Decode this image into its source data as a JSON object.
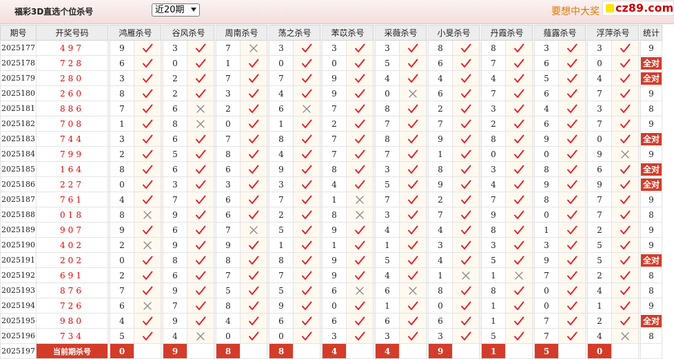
{
  "header": {
    "title": "福彩3D直选个位杀号",
    "period_select": "近20期",
    "promo": "要想中大奖",
    "brand": "cz89.com"
  },
  "table": {
    "columns": {
      "issue": "期号",
      "draw": "开奖号码",
      "stat": "统计",
      "experts": [
        "鸿雁杀号",
        "谷风杀号",
        "周南杀号",
        "荡之杀号",
        "苯苡杀号",
        "采薇杀号",
        "小旻杀号",
        "丹霞杀号",
        "薤露杀号",
        "浮萍杀号"
      ]
    },
    "rows": [
      {
        "issue": "2025177",
        "draw": "497",
        "picks": [
          [
            "9",
            "ok"
          ],
          [
            "3",
            "ok"
          ],
          [
            "7",
            "x"
          ],
          [
            "3",
            "ok"
          ],
          [
            "3",
            "ok"
          ],
          [
            "3",
            "ok"
          ],
          [
            "8",
            "ok"
          ],
          [
            "8",
            "ok"
          ],
          [
            "3",
            "ok"
          ],
          [
            "3",
            "ok"
          ]
        ],
        "stat": "9"
      },
      {
        "issue": "2025178",
        "draw": "728",
        "picks": [
          [
            "6",
            "ok"
          ],
          [
            "0",
            "ok"
          ],
          [
            "1",
            "ok"
          ],
          [
            "0",
            "ok"
          ],
          [
            "0",
            "ok"
          ],
          [
            "5",
            "ok"
          ],
          [
            "6",
            "ok"
          ],
          [
            "7",
            "ok"
          ],
          [
            "6",
            "ok"
          ],
          [
            "0",
            "ok"
          ]
        ],
        "stat": "全对"
      },
      {
        "issue": "2025179",
        "draw": "280",
        "picks": [
          [
            "3",
            "ok"
          ],
          [
            "2",
            "ok"
          ],
          [
            "7",
            "ok"
          ],
          [
            "7",
            "ok"
          ],
          [
            "9",
            "ok"
          ],
          [
            "4",
            "ok"
          ],
          [
            "4",
            "ok"
          ],
          [
            "4",
            "ok"
          ],
          [
            "5",
            "ok"
          ],
          [
            "4",
            "ok"
          ]
        ],
        "stat": "全对"
      },
      {
        "issue": "2025180",
        "draw": "260",
        "picks": [
          [
            "8",
            "ok"
          ],
          [
            "2",
            "ok"
          ],
          [
            "3",
            "ok"
          ],
          [
            "4",
            "ok"
          ],
          [
            "9",
            "ok"
          ],
          [
            "0",
            "x"
          ],
          [
            "6",
            "ok"
          ],
          [
            "7",
            "ok"
          ],
          [
            "6",
            "ok"
          ],
          [
            "7",
            "ok"
          ]
        ],
        "stat": "9"
      },
      {
        "issue": "2025181",
        "draw": "886",
        "picks": [
          [
            "7",
            "ok"
          ],
          [
            "6",
            "x"
          ],
          [
            "2",
            "ok"
          ],
          [
            "6",
            "x"
          ],
          [
            "7",
            "ok"
          ],
          [
            "8",
            "ok"
          ],
          [
            "2",
            "ok"
          ],
          [
            "3",
            "ok"
          ],
          [
            "4",
            "ok"
          ],
          [
            "3",
            "ok"
          ]
        ],
        "stat": "8"
      },
      {
        "issue": "2025182",
        "draw": "708",
        "picks": [
          [
            "1",
            "ok"
          ],
          [
            "8",
            "x"
          ],
          [
            "0",
            "ok"
          ],
          [
            "1",
            "ok"
          ],
          [
            "2",
            "ok"
          ],
          [
            "7",
            "ok"
          ],
          [
            "7",
            "ok"
          ],
          [
            "2",
            "ok"
          ],
          [
            "6",
            "ok"
          ],
          [
            "7",
            "ok"
          ]
        ],
        "stat": "9"
      },
      {
        "issue": "2025183",
        "draw": "744",
        "picks": [
          [
            "3",
            "ok"
          ],
          [
            "6",
            "ok"
          ],
          [
            "7",
            "ok"
          ],
          [
            "8",
            "ok"
          ],
          [
            "7",
            "ok"
          ],
          [
            "8",
            "ok"
          ],
          [
            "9",
            "ok"
          ],
          [
            "8",
            "ok"
          ],
          [
            "9",
            "ok"
          ],
          [
            "0",
            "ok"
          ]
        ],
        "stat": "全对"
      },
      {
        "issue": "2025184",
        "draw": "799",
        "picks": [
          [
            "2",
            "ok"
          ],
          [
            "5",
            "ok"
          ],
          [
            "8",
            "ok"
          ],
          [
            "4",
            "ok"
          ],
          [
            "7",
            "ok"
          ],
          [
            "7",
            "ok"
          ],
          [
            "1",
            "ok"
          ],
          [
            "0",
            "ok"
          ],
          [
            "0",
            "ok"
          ],
          [
            "9",
            "x"
          ]
        ],
        "stat": "9"
      },
      {
        "issue": "2025185",
        "draw": "164",
        "picks": [
          [
            "8",
            "ok"
          ],
          [
            "6",
            "ok"
          ],
          [
            "6",
            "ok"
          ],
          [
            "9",
            "ok"
          ],
          [
            "8",
            "ok"
          ],
          [
            "3",
            "ok"
          ],
          [
            "8",
            "ok"
          ],
          [
            "3",
            "ok"
          ],
          [
            "8",
            "ok"
          ],
          [
            "6",
            "ok"
          ]
        ],
        "stat": "全对"
      },
      {
        "issue": "2025186",
        "draw": "227",
        "picks": [
          [
            "0",
            "ok"
          ],
          [
            "3",
            "ok"
          ],
          [
            "3",
            "ok"
          ],
          [
            "3",
            "ok"
          ],
          [
            "4",
            "ok"
          ],
          [
            "5",
            "ok"
          ],
          [
            "9",
            "ok"
          ],
          [
            "4",
            "ok"
          ],
          [
            "9",
            "ok"
          ],
          [
            "9",
            "ok"
          ]
        ],
        "stat": "全对"
      },
      {
        "issue": "2025187",
        "draw": "761",
        "picks": [
          [
            "4",
            "ok"
          ],
          [
            "7",
            "ok"
          ],
          [
            "6",
            "ok"
          ],
          [
            "7",
            "ok"
          ],
          [
            "1",
            "x"
          ],
          [
            "7",
            "ok"
          ],
          [
            "2",
            "ok"
          ],
          [
            "7",
            "ok"
          ],
          [
            "8",
            "ok"
          ],
          [
            "7",
            "ok"
          ]
        ],
        "stat": "9"
      },
      {
        "issue": "2025188",
        "draw": "018",
        "picks": [
          [
            "8",
            "x"
          ],
          [
            "9",
            "ok"
          ],
          [
            "6",
            "ok"
          ],
          [
            "2",
            "ok"
          ],
          [
            "8",
            "x"
          ],
          [
            "3",
            "ok"
          ],
          [
            "7",
            "ok"
          ],
          [
            "9",
            "ok"
          ],
          [
            "0",
            "ok"
          ],
          [
            "7",
            "ok"
          ]
        ],
        "stat": "8"
      },
      {
        "issue": "2025189",
        "draw": "907",
        "picks": [
          [
            "9",
            "ok"
          ],
          [
            "6",
            "ok"
          ],
          [
            "7",
            "x"
          ],
          [
            "5",
            "ok"
          ],
          [
            "9",
            "ok"
          ],
          [
            "4",
            "ok"
          ],
          [
            "4",
            "ok"
          ],
          [
            "8",
            "ok"
          ],
          [
            "1",
            "ok"
          ],
          [
            "2",
            "ok"
          ]
        ],
        "stat": "9"
      },
      {
        "issue": "2025190",
        "draw": "402",
        "picks": [
          [
            "2",
            "x"
          ],
          [
            "9",
            "ok"
          ],
          [
            "9",
            "ok"
          ],
          [
            "1",
            "ok"
          ],
          [
            "1",
            "ok"
          ],
          [
            "1",
            "ok"
          ],
          [
            "3",
            "ok"
          ],
          [
            "3",
            "ok"
          ],
          [
            "3",
            "ok"
          ],
          [
            "5",
            "ok"
          ]
        ],
        "stat": "9"
      },
      {
        "issue": "2025191",
        "draw": "202",
        "picks": [
          [
            "0",
            "ok"
          ],
          [
            "8",
            "ok"
          ],
          [
            "8",
            "ok"
          ],
          [
            "8",
            "ok"
          ],
          [
            "9",
            "ok"
          ],
          [
            "5",
            "ok"
          ],
          [
            "4",
            "ok"
          ],
          [
            "5",
            "ok"
          ],
          [
            "9",
            "ok"
          ],
          [
            "5",
            "ok"
          ]
        ],
        "stat": "全对"
      },
      {
        "issue": "2025192",
        "draw": "691",
        "picks": [
          [
            "2",
            "ok"
          ],
          [
            "6",
            "ok"
          ],
          [
            "7",
            "ok"
          ],
          [
            "7",
            "ok"
          ],
          [
            "9",
            "ok"
          ],
          [
            "4",
            "ok"
          ],
          [
            "1",
            "x"
          ],
          [
            "1",
            "x"
          ],
          [
            "7",
            "ok"
          ],
          [
            "2",
            "ok"
          ]
        ],
        "stat": "8"
      },
      {
        "issue": "2025193",
        "draw": "876",
        "picks": [
          [
            "7",
            "ok"
          ],
          [
            "9",
            "ok"
          ],
          [
            "5",
            "ok"
          ],
          [
            "5",
            "ok"
          ],
          [
            "6",
            "x"
          ],
          [
            "6",
            "x"
          ],
          [
            "8",
            "ok"
          ],
          [
            "8",
            "ok"
          ],
          [
            "0",
            "ok"
          ],
          [
            "4",
            "ok"
          ]
        ],
        "stat": "8"
      },
      {
        "issue": "2025194",
        "draw": "726",
        "picks": [
          [
            "6",
            "x"
          ],
          [
            "7",
            "ok"
          ],
          [
            "8",
            "ok"
          ],
          [
            "9",
            "ok"
          ],
          [
            "0",
            "ok"
          ],
          [
            "1",
            "ok"
          ],
          [
            "0",
            "ok"
          ],
          [
            "1",
            "ok"
          ],
          [
            "0",
            "ok"
          ],
          [
            "1",
            "ok"
          ]
        ],
        "stat": "9"
      },
      {
        "issue": "2025195",
        "draw": "980",
        "picks": [
          [
            "4",
            "ok"
          ],
          [
            "9",
            "ok"
          ],
          [
            "4",
            "ok"
          ],
          [
            "6",
            "ok"
          ],
          [
            "6",
            "ok"
          ],
          [
            "6",
            "ok"
          ],
          [
            "6",
            "ok"
          ],
          [
            "1",
            "ok"
          ],
          [
            "7",
            "ok"
          ],
          [
            "2",
            "ok"
          ]
        ],
        "stat": "全对"
      },
      {
        "issue": "2025196",
        "draw": "734",
        "picks": [
          [
            "5",
            "ok"
          ],
          [
            "4",
            "x"
          ],
          [
            "0",
            "ok"
          ],
          [
            "0",
            "ok"
          ],
          [
            "3",
            "ok"
          ],
          [
            "3",
            "ok"
          ],
          [
            "3",
            "ok"
          ],
          [
            "5",
            "ok"
          ],
          [
            "7",
            "ok"
          ],
          [
            "4",
            "x"
          ]
        ],
        "stat": "8"
      }
    ],
    "current": {
      "issue": "2025197",
      "label": "当前期杀号",
      "picks": [
        "0",
        "9",
        "8",
        "8",
        "4",
        "4",
        "9",
        "1",
        "5",
        "0"
      ]
    }
  },
  "colors": {
    "accent_red": "#d43c2a",
    "check_red": "#e8202a",
    "cross_gray": "#8a8a8a",
    "draw_red": "#e00000",
    "promo_orange": "#e07a00"
  }
}
